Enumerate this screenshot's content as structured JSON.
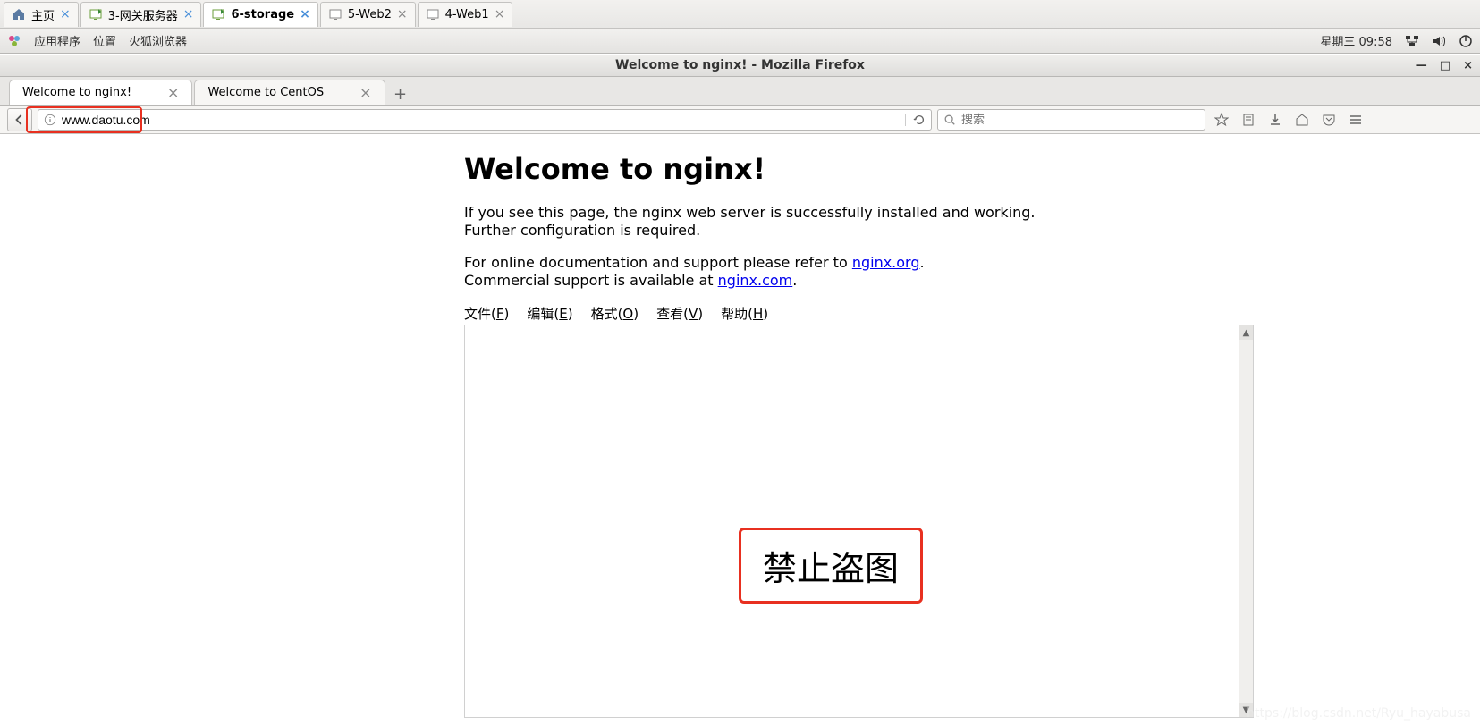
{
  "vm_tabs": [
    {
      "label": "主页"
    },
    {
      "label": "3-网关服务器"
    },
    {
      "label": "6-storage"
    },
    {
      "label": "5-Web2"
    },
    {
      "label": "4-Web1"
    }
  ],
  "vm_tabs_active_index": 2,
  "panel": {
    "apps": "应用程序",
    "places": "位置",
    "firefox": "火狐浏览器",
    "clock": "星期三 09:58"
  },
  "window": {
    "title": "Welcome to nginx! - Mozilla Firefox"
  },
  "browser_tabs": [
    {
      "label": "Welcome to nginx!"
    },
    {
      "label": "Welcome to CentOS"
    }
  ],
  "url": "www.daotu.com",
  "search_placeholder": "搜索",
  "nginx": {
    "heading": "Welcome to nginx!",
    "p1a": "If you see this page, the nginx web server is successfully installed and working.",
    "p1b": "Further configuration is required.",
    "p2a": "For online documentation and support please refer to ",
    "p2a_link": "nginx.org",
    "p2b": "Commercial support is available at ",
    "p2b_link": "nginx.com"
  },
  "notepad_menu": {
    "file": "文件(",
    "file_key": "F",
    "file_end": ")",
    "edit": "编辑(",
    "edit_key": "E",
    "edit_end": ")",
    "format": "格式(",
    "format_key": "O",
    "format_end": ")",
    "view": "查看(",
    "view_key": "V",
    "view_end": ")",
    "help": "帮助(",
    "help_key": "H",
    "help_end": ")"
  },
  "watermark_text": "禁止盗图",
  "bottom_watermark": "https://blog.csdn.net/Ryu_hayabusa"
}
